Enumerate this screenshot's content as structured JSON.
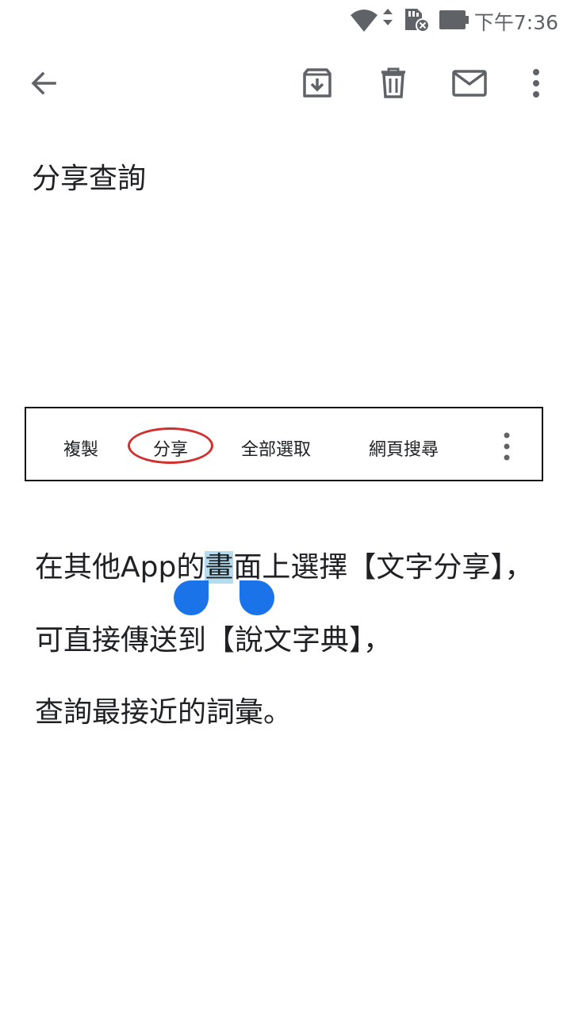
{
  "status_bar": {
    "time": "下午7:36",
    "icons": [
      "wifi-icon",
      "sd-card-error-icon",
      "battery-icon"
    ]
  },
  "toolbar": {
    "back_icon": "arrow-back-icon",
    "actions": [
      "archive-icon",
      "delete-icon",
      "mail-icon",
      "more-vert-icon"
    ]
  },
  "email": {
    "subject": "分享查詢"
  },
  "context_menu": {
    "items": [
      "複製",
      "分享",
      "全部選取",
      "網頁搜尋"
    ],
    "highlighted_item": "分享",
    "highlight_color": "#d0302f",
    "overflow_icon": "more-vert-icon"
  },
  "body": {
    "line1_before": "在其他App的",
    "line1_selected": "畫",
    "line1_after": "面上選擇【文字分享】，",
    "line2": "可直接傳送到【說文字典】，",
    "line3": "查詢最接近的詞彙。",
    "selection_color": "#b3dcef",
    "handle_color": "#1a73e8"
  }
}
